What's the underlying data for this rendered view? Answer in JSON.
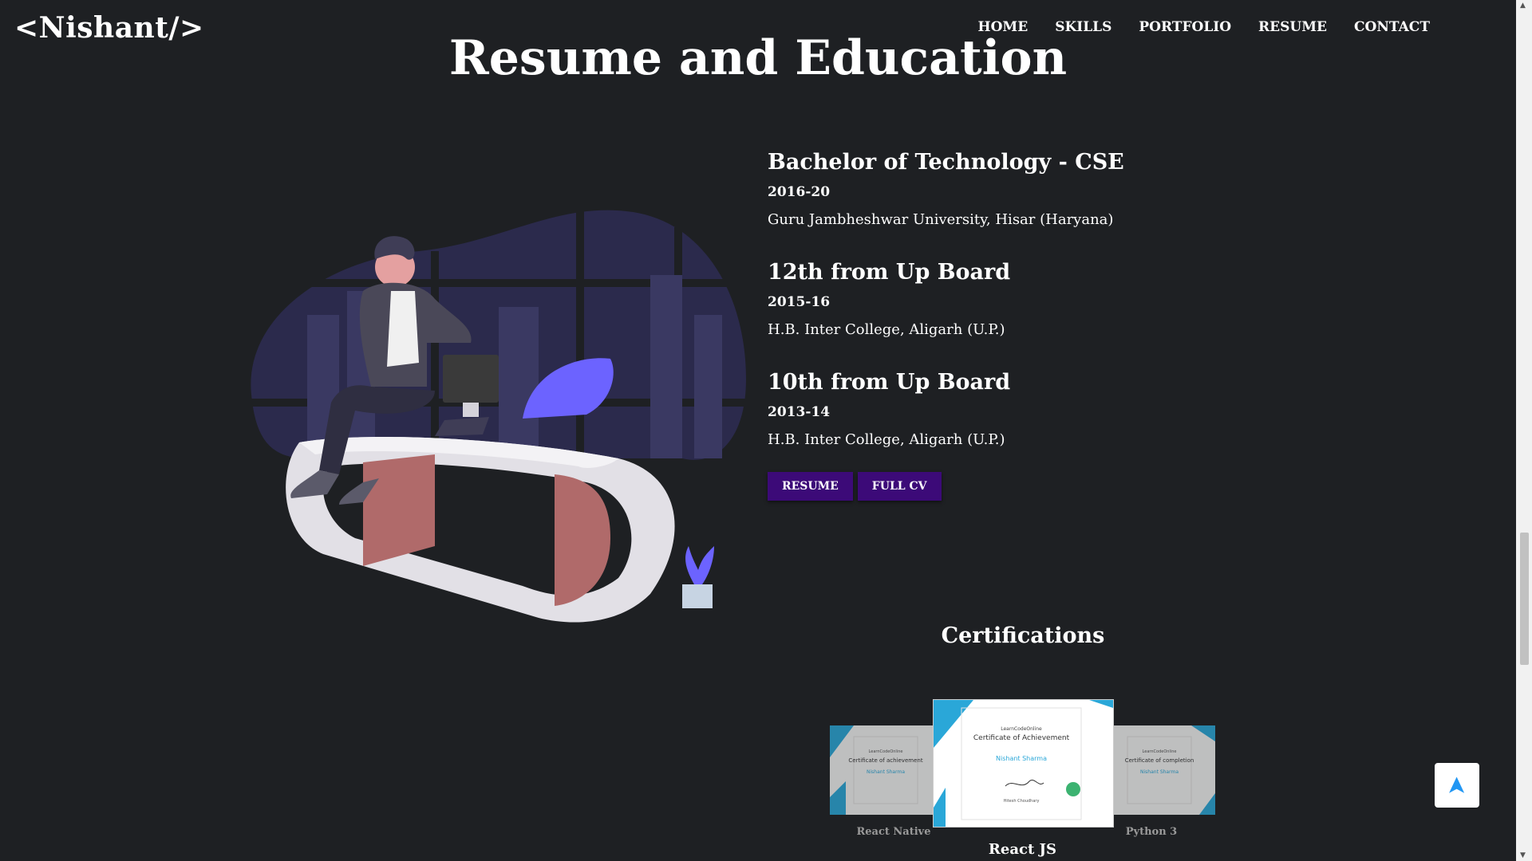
{
  "header": {
    "logo": "<Nishant/>",
    "nav": [
      "HOME",
      "SKILLS",
      "PORTFOLIO",
      "RESUME",
      "CONTACT"
    ]
  },
  "section_title": "Resume and Education",
  "education": [
    {
      "title": "Bachelor of Technology - CSE",
      "years": "2016-20",
      "school": "Guru Jambheshwar University, Hisar (Haryana)"
    },
    {
      "title": "12th from Up Board",
      "years": "2015-16",
      "school": "H.B. Inter College, Aligarh (U.P.)"
    },
    {
      "title": "10th from Up Board",
      "years": "2013-14",
      "school": "H.B. Inter College, Aligarh (U.P.)"
    }
  ],
  "buttons": {
    "resume": "RESUME",
    "full_cv": "FULL CV"
  },
  "certifications": {
    "heading": "Certifications",
    "items": [
      {
        "caption": "React Native",
        "certificate_title": "Certificate of achievement",
        "issuer": "LearnCodeOnline",
        "name": "Nishant Sharma"
      },
      {
        "caption": "React JS",
        "certificate_title": "Certificate of Achievement",
        "issuer": "LearnCodeOnline",
        "name": "Nishant Sharma",
        "signer": "Hitesh Choudhary"
      },
      {
        "caption": "Python 3",
        "certificate_title": "Certificate of completion",
        "issuer": "LearnCodeOnline",
        "name": "Nishant Sharma"
      }
    ]
  },
  "colors": {
    "background": "#1e2023",
    "button": "#3c0a78",
    "accent_purple": "#6c63ff",
    "desk_pink": "#b06a6a",
    "to_top_arrow": "#2196f3"
  },
  "icons": {
    "scroll_top": "arrow-up-icon"
  }
}
